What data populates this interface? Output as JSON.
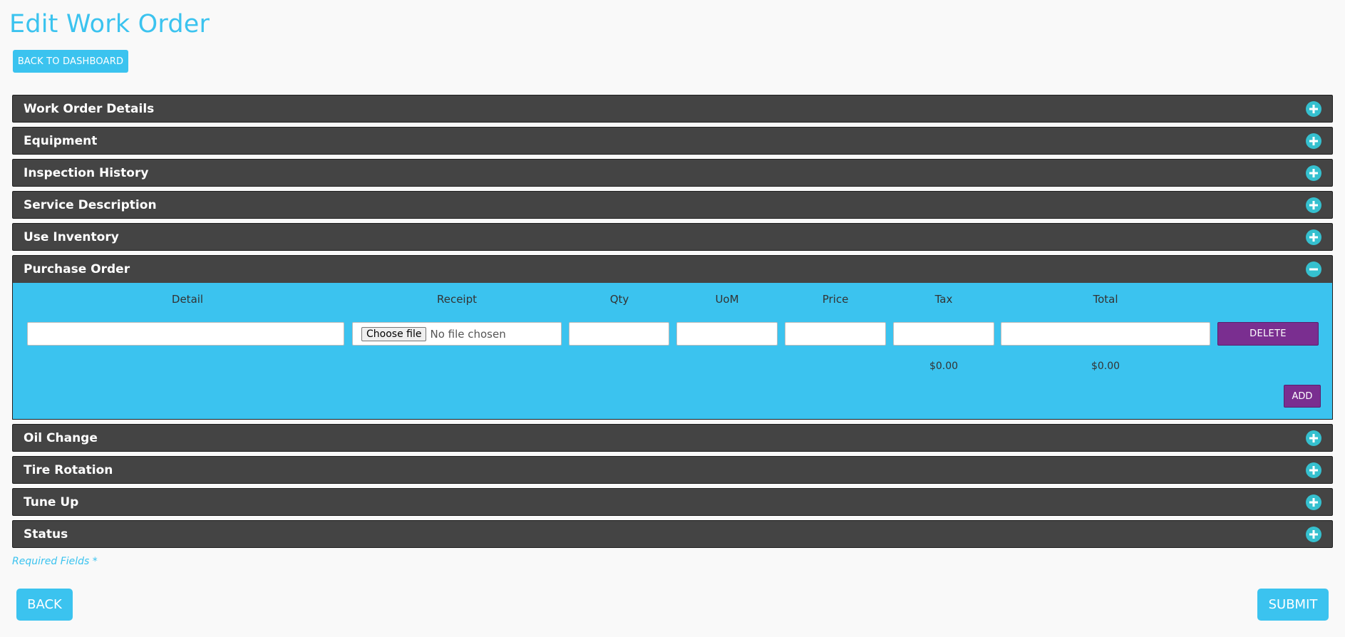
{
  "page": {
    "title": "Edit Work Order",
    "back_to_dashboard": "BACK TO DASHBOARD"
  },
  "panels": [
    {
      "title": "Work Order Details",
      "state": "collapsed"
    },
    {
      "title": "Equipment",
      "state": "collapsed"
    },
    {
      "title": "Inspection History",
      "state": "collapsed"
    },
    {
      "title": "Service Description",
      "state": "collapsed"
    },
    {
      "title": "Use Inventory",
      "state": "collapsed"
    },
    {
      "title": "Purchase Order",
      "state": "expanded"
    },
    {
      "title": "Oil Change",
      "state": "collapsed"
    },
    {
      "title": "Tire Rotation",
      "state": "collapsed"
    },
    {
      "title": "Tune Up",
      "state": "collapsed"
    },
    {
      "title": "Status",
      "state": "collapsed"
    }
  ],
  "purchase_order": {
    "columns": [
      "Detail",
      "Receipt",
      "Qty",
      "UoM",
      "Price",
      "Tax",
      "Total"
    ],
    "row": {
      "detail": "",
      "file_button": "Choose file",
      "file_status": "No file chosen",
      "qty": "",
      "uom": "",
      "price": "",
      "tax": "",
      "total": ""
    },
    "delete_label": "DELETE",
    "tax_total": "$0.00",
    "grand_total": "$0.00",
    "add_label": "ADD"
  },
  "footer": {
    "required_note": "Required Fields *",
    "back_label": "BACK",
    "submit_label": "SUBMIT"
  },
  "colors": {
    "accent": "#3bc3ef",
    "panel_header": "#444444",
    "toggle_icon": "#35c0cf",
    "action_purple": "#7a2e90"
  }
}
